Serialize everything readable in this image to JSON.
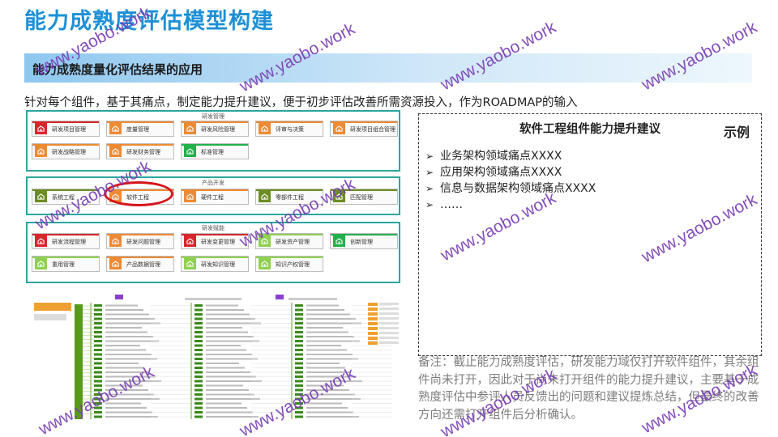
{
  "page": {
    "title": "能力成熟度评估模型构建",
    "section_title": "能力成熟度量化评估结果的应用",
    "intro": "针对每个组件，基于其痛点，制定能力提升建议，便于初步评估改善所需资源投入，作为ROADMAP的输入"
  },
  "groups": [
    {
      "title": "研发管理",
      "cards": [
        {
          "label": "研发项目管理",
          "color": "#d8262c"
        },
        {
          "label": "度量管理",
          "color": "#ee8a34"
        },
        {
          "label": "研发风险管理",
          "color": "#ee8a34"
        },
        {
          "label": "评审与决策",
          "color": "#ee8a34"
        },
        {
          "label": "研发项目组合管理",
          "color": "#ee8a34"
        },
        {
          "label": "研发战略管理",
          "color": "#ee8a34"
        },
        {
          "label": "研发财务管理",
          "color": "#ee8a34"
        },
        {
          "label": "标准管理",
          "color": "#22b04b"
        }
      ]
    },
    {
      "title": "产品开发",
      "cards": [
        {
          "label": "系统工程",
          "color": "#6b8e23"
        },
        {
          "label": "软件工程",
          "color": "#ee8a34"
        },
        {
          "label": "硬件工程",
          "color": "#ee8a34"
        },
        {
          "label": "零部件工程",
          "color": "#6b8e23"
        },
        {
          "label": "匹配管理",
          "color": "#6b8e23"
        }
      ]
    },
    {
      "title": "研发赋能",
      "cards": [
        {
          "label": "研发流程管理",
          "color": "#d8262c"
        },
        {
          "label": "研发问题管理",
          "color": "#ee8a34"
        },
        {
          "label": "研发变更管理",
          "color": "#d8262c"
        },
        {
          "label": "研发资产管理",
          "color": "#8fd14f"
        },
        {
          "label": "创新管理",
          "color": "#22b04b"
        },
        {
          "label": "重用管理",
          "color": "#8fd14f"
        },
        {
          "label": "产品数据管理",
          "color": "#ee8a34"
        },
        {
          "label": "研发知识管理",
          "color": "#8fd14f"
        },
        {
          "label": "知识产权管理",
          "color": "#8fd14f"
        }
      ]
    }
  ],
  "example": {
    "title": "软件工程组件能力提升建议",
    "tag": "示例",
    "items": [
      "业务架构领域痛点XXXX",
      "应用架构领域痛点XXXX",
      "信息与数据架构领域痛点XXXX",
      "……"
    ]
  },
  "note": "备注：截止能力成熟度评估，研发能力域仅打开软件组件，其余组件尚未打开，因此对于尚未打开组件的能力提升建议，主要基于成熟度评估中参评人员反馈出的问题和建议提炼总结，但最终的改善方向还需打开组件后分析确认。",
  "watermark": "www.yaobo.work",
  "colors": {
    "title": "#1e90d6",
    "group_border": "#2aa6a0",
    "highlight": "#d6141b",
    "watermark": "#7a3fb5"
  }
}
